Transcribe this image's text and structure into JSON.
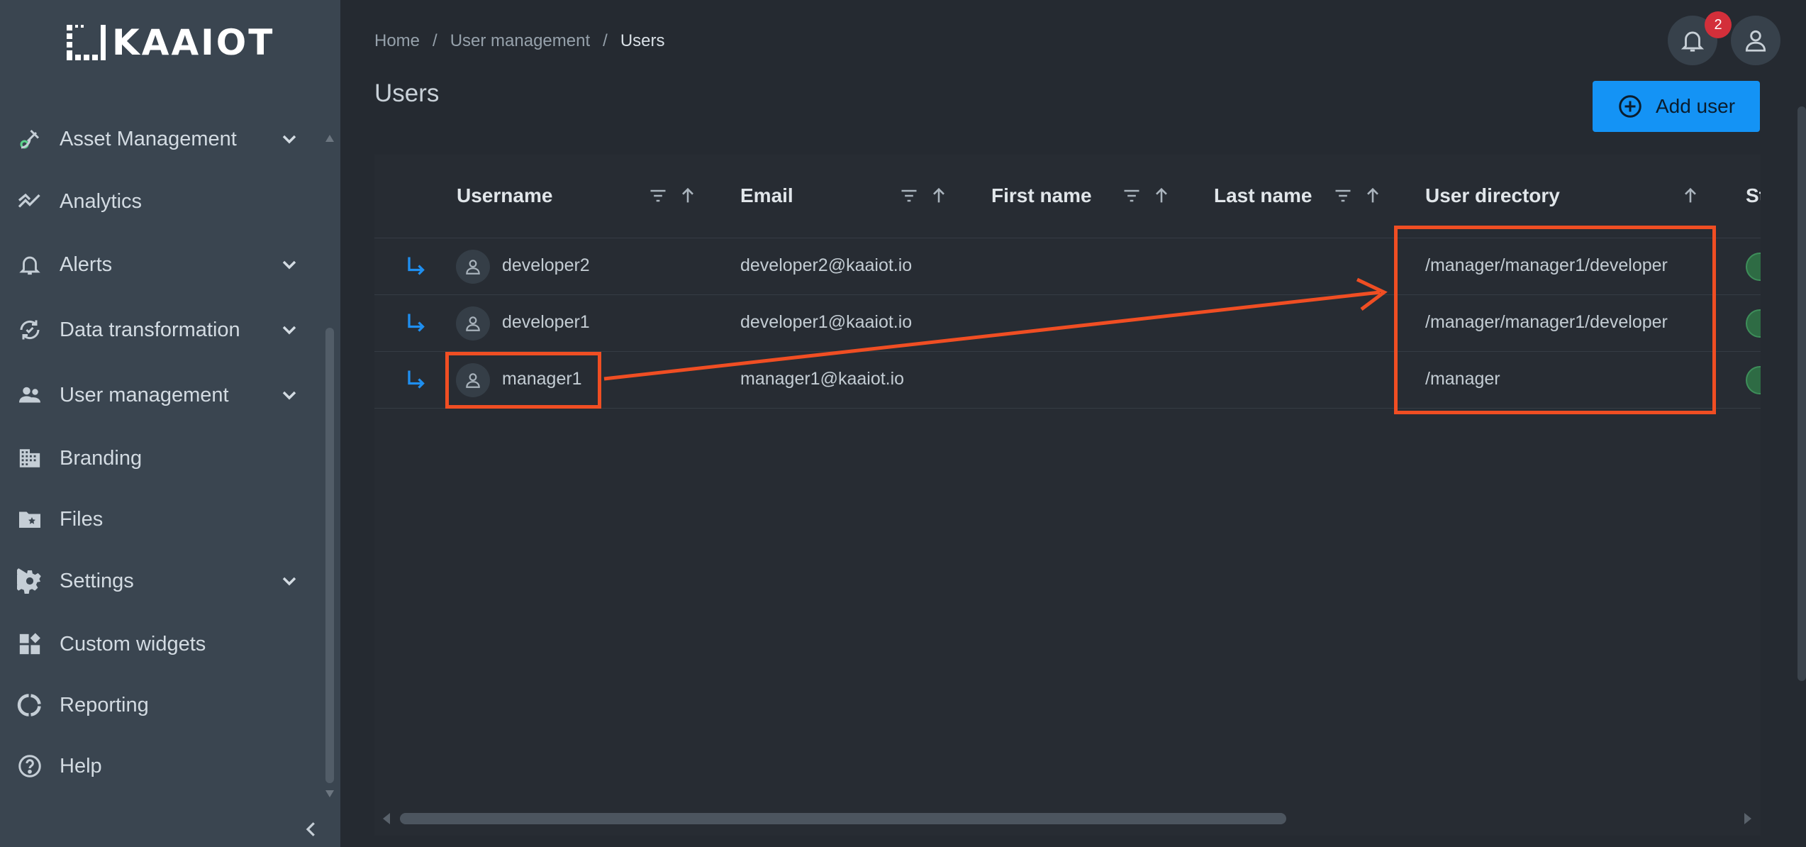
{
  "app": {
    "logo_text": "KAAIOT"
  },
  "sidebar": {
    "items": [
      {
        "label": "Asset Management",
        "icon": "satellite-icon",
        "has_chevron": true
      },
      {
        "label": "Analytics",
        "icon": "analytics-icon",
        "has_chevron": false
      },
      {
        "label": "Alerts",
        "icon": "bell-icon",
        "has_chevron": true
      },
      {
        "label": "Data transformation",
        "icon": "sync-icon",
        "has_chevron": true
      },
      {
        "label": "User management",
        "icon": "users-icon",
        "has_chevron": true
      },
      {
        "label": "Branding",
        "icon": "building-icon",
        "has_chevron": false
      },
      {
        "label": "Files",
        "icon": "folder-star-icon",
        "has_chevron": false
      },
      {
        "label": "Settings",
        "icon": "gear-icon",
        "has_chevron": true
      },
      {
        "label": "Custom widgets",
        "icon": "widgets-icon",
        "has_chevron": false
      },
      {
        "label": "Reporting",
        "icon": "donut-icon",
        "has_chevron": false
      },
      {
        "label": "Help",
        "icon": "help-icon",
        "has_chevron": false
      }
    ]
  },
  "header": {
    "breadcrumb": [
      "Home",
      "User management",
      "Users"
    ],
    "separator": "/",
    "title": "Users",
    "notifications_count": "2",
    "add_user_label": "Add user"
  },
  "table": {
    "columns": [
      "Username",
      "Email",
      "First name",
      "Last name",
      "User directory",
      "St"
    ],
    "rows": [
      {
        "username": "developer2",
        "email": "developer2@kaaiot.io",
        "first_name": "",
        "last_name": "",
        "directory": "/manager/manager1/developer"
      },
      {
        "username": "developer1",
        "email": "developer1@kaaiot.io",
        "first_name": "",
        "last_name": "",
        "directory": "/manager/manager1/developer"
      },
      {
        "username": "manager1",
        "email": "manager1@kaaiot.io",
        "first_name": "",
        "last_name": "",
        "directory": "/manager"
      }
    ]
  },
  "colors": {
    "accent": "#1493f5",
    "annotation": "#f04e23",
    "badge": "#d32f3a",
    "status_active": "#2e6b44"
  }
}
